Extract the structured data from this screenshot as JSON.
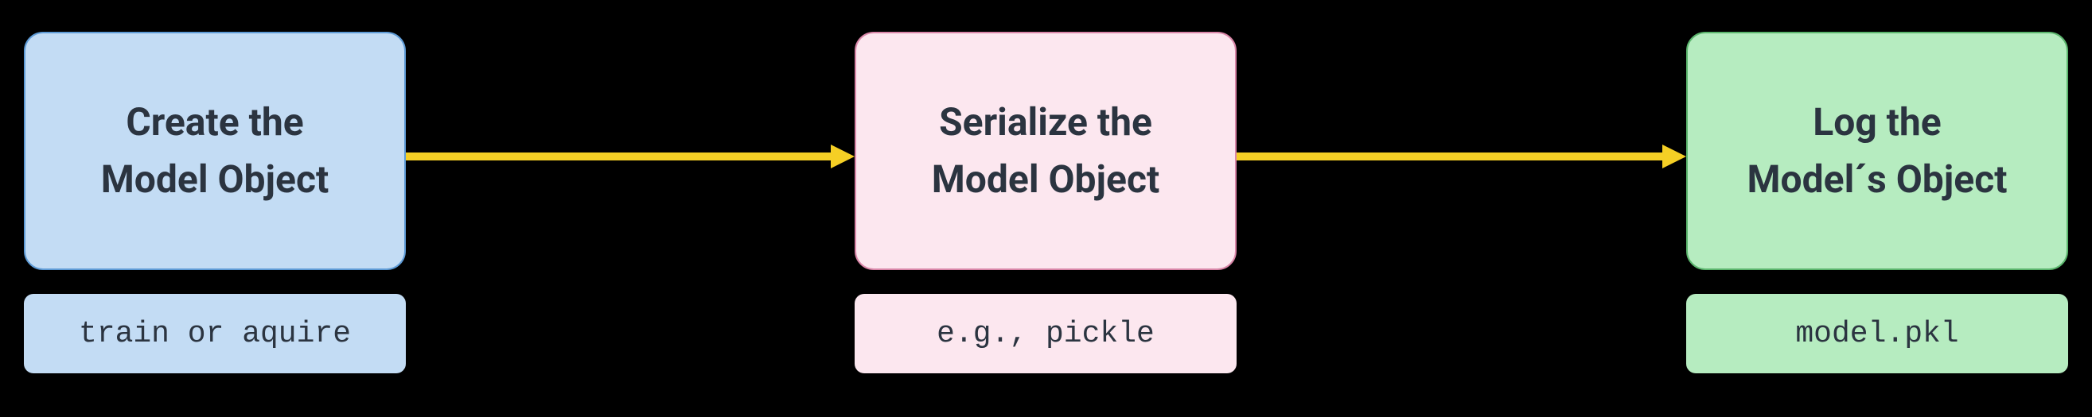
{
  "steps": [
    {
      "title_line1": "Create the",
      "title_line2": "Model Object",
      "subtitle": "train or aquire",
      "color_main": "#c3dcf4",
      "color_border": "#5e9bd6"
    },
    {
      "title_line1": "Serialize the",
      "title_line2": "Model Object",
      "subtitle": "e.g., pickle",
      "color_main": "#fce7ef",
      "color_border": "#d986a8"
    },
    {
      "title_line1": "Log the",
      "title_line2": "Model´s Object",
      "subtitle": "model.pkl",
      "color_main": "#b6ecc0",
      "color_border": "#5bb56d"
    }
  ],
  "arrow_color": "#f5cf25"
}
